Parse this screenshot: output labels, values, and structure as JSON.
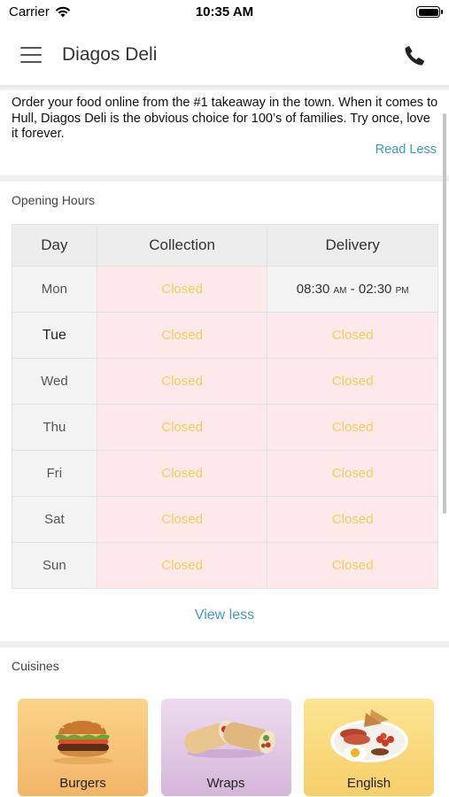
{
  "status_bar": {
    "carrier": "Carrier",
    "time": "10:35 AM"
  },
  "navbar": {
    "title": "Diagos Deli",
    "menu_icon": "hamburger-icon",
    "phone_icon": "phone-icon"
  },
  "about": {
    "text": "Order your food online from the #1 takeaway in the town. When it comes to Hull, Diagos Deli is the obvious choice for 100’s of families. Try once, love it forever.",
    "toggle_label": "Read Less"
  },
  "opening_hours": {
    "title": "Opening Hours",
    "headers": [
      "Day",
      "Collection",
      "Delivery"
    ],
    "rows": [
      {
        "day": "Mon",
        "collection": "Closed",
        "delivery_start": "08:30",
        "delivery_start_suffix": "AM",
        "delivery_sep": " - ",
        "delivery_end": "02:30",
        "delivery_end_suffix": "PM"
      },
      {
        "day": "Tue",
        "collection": "Closed",
        "delivery": "Closed"
      },
      {
        "day": "Wed",
        "collection": "Closed",
        "delivery": "Closed"
      },
      {
        "day": "Thu",
        "collection": "Closed",
        "delivery": "Closed"
      },
      {
        "day": "Fri",
        "collection": "Closed",
        "delivery": "Closed"
      },
      {
        "day": "Sat",
        "collection": "Closed",
        "delivery": "Closed"
      },
      {
        "day": "Sun",
        "collection": "Closed",
        "delivery": "Closed"
      }
    ],
    "toggle_label": "View less"
  },
  "cuisines": {
    "title": "Cuisines",
    "items": [
      {
        "label": "Burgers",
        "icon": "burger-icon"
      },
      {
        "label": "Wraps",
        "icon": "wrap-icon"
      },
      {
        "label": "English",
        "icon": "english-breakfast-icon"
      }
    ]
  },
  "colors": {
    "accent": "#3b9dc4",
    "closed_bg": "#fde9e9",
    "closed_text": "#f2cf5a"
  }
}
